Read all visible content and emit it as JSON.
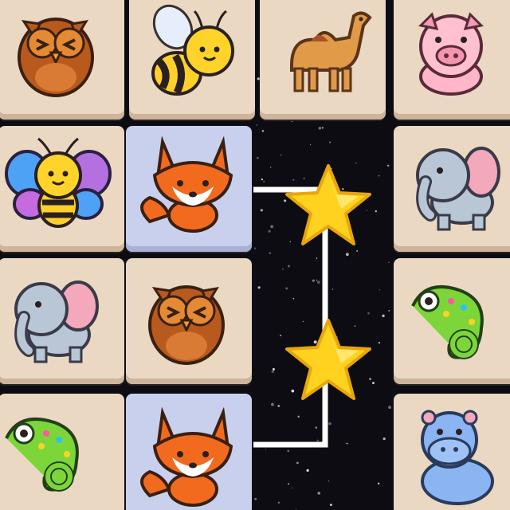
{
  "game": {
    "board": {
      "rows": [
        [
          "owl",
          "bee",
          "camel",
          "pig"
        ],
        [
          "butterfly-bee",
          "fox",
          "",
          "elephant"
        ],
        [
          "elephant",
          "owl",
          "",
          "chameleon"
        ],
        [
          "chameleon",
          "fox",
          "",
          "hippo"
        ]
      ],
      "selected_tiles": [
        [
          1,
          1
        ],
        [
          3,
          1
        ]
      ],
      "match_connector_stars": 2
    },
    "colors": {
      "tile": "#ead8c3",
      "tile_selected": "#c9d0ee",
      "path_line": "#ffffff",
      "star": "#ffd21f",
      "background": "#0c0c12"
    }
  }
}
